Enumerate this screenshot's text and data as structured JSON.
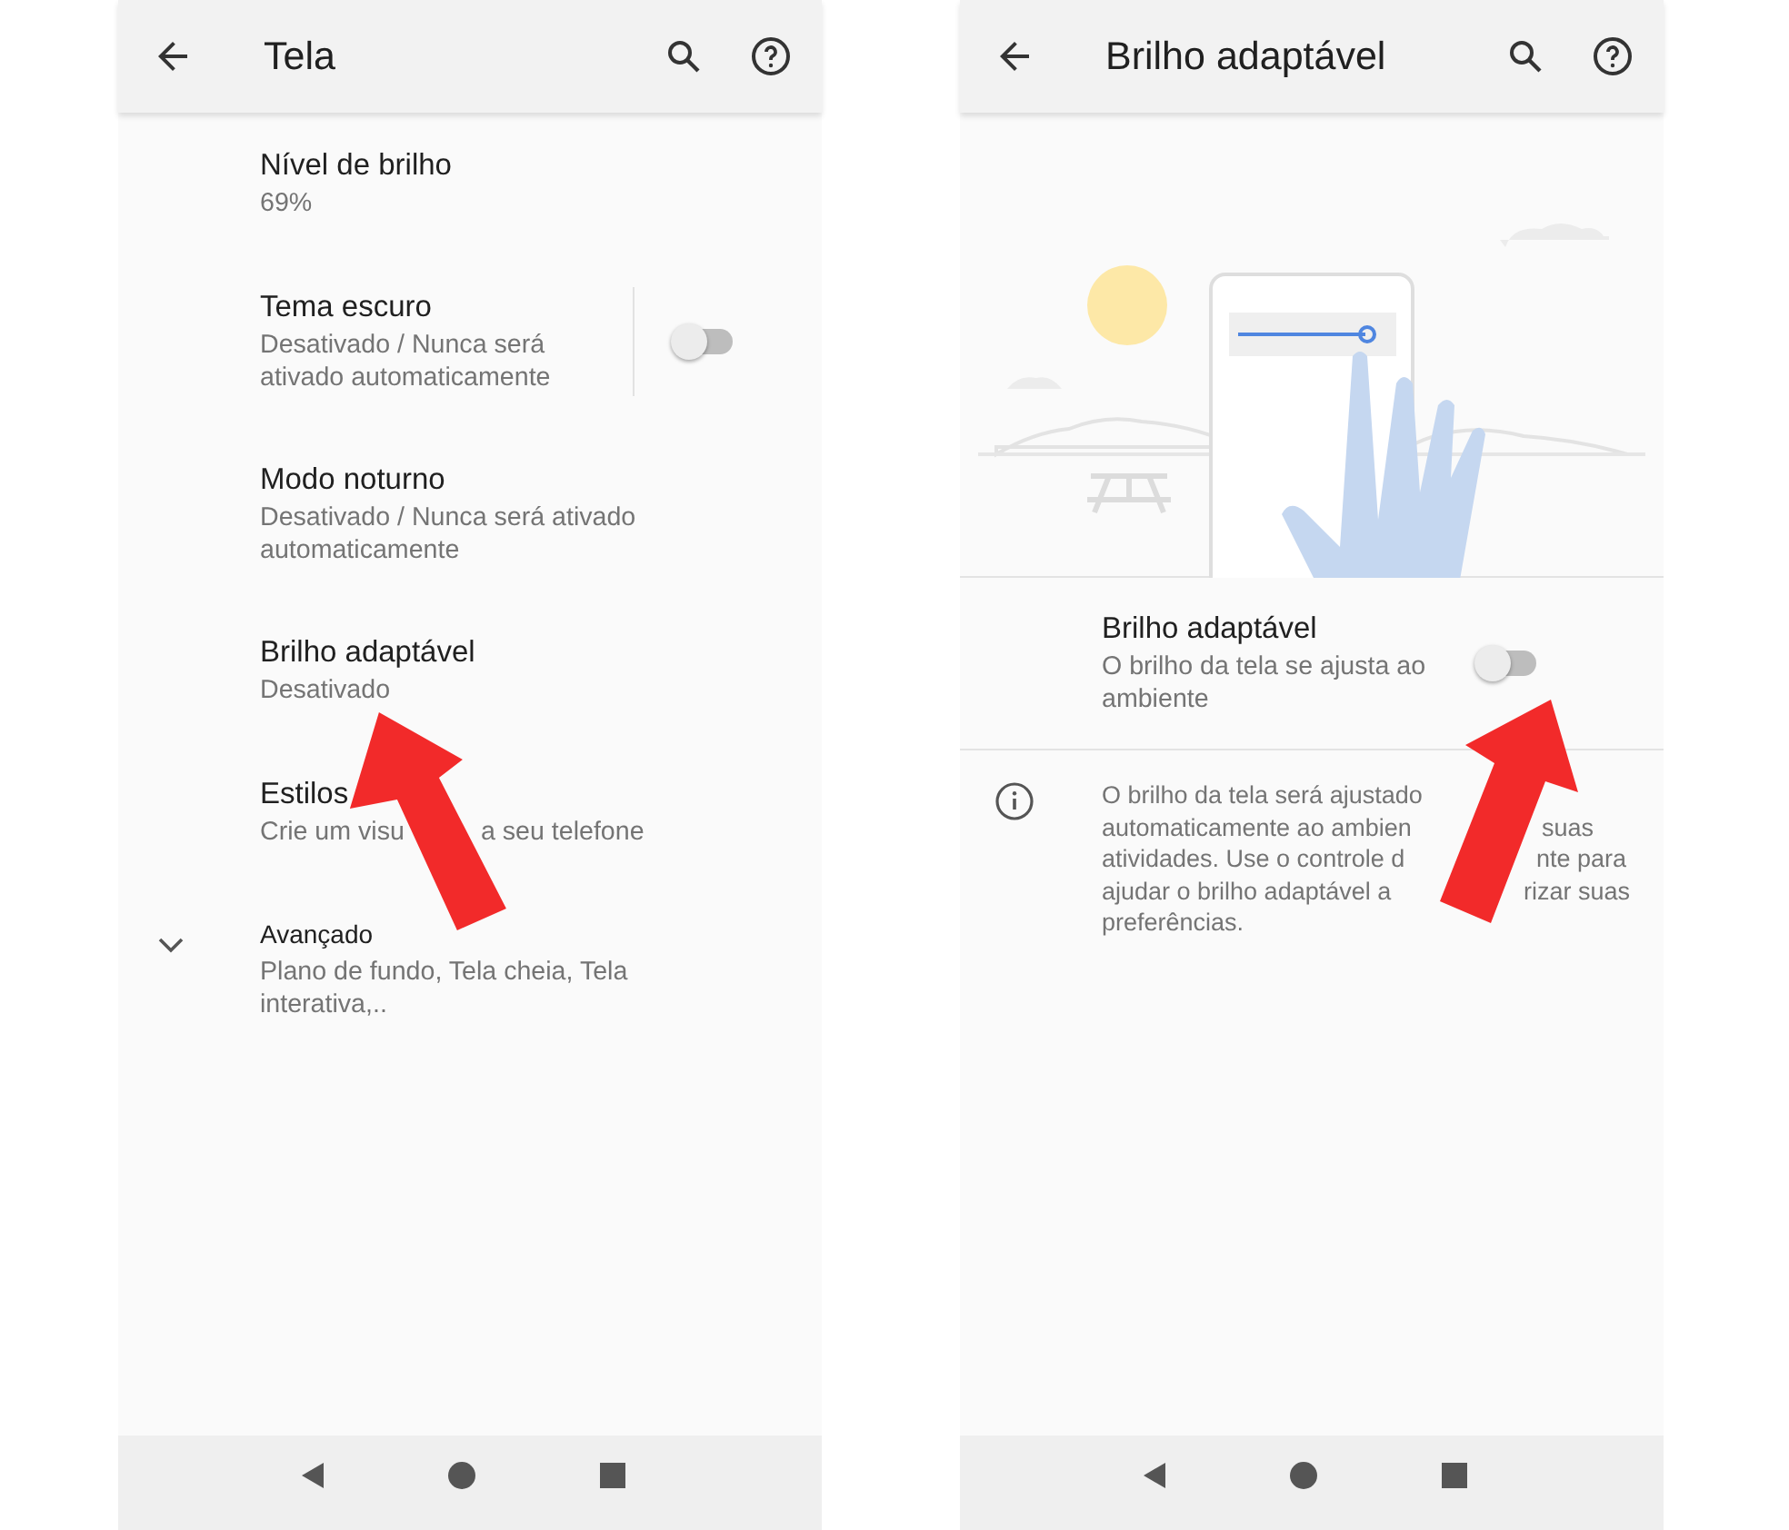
{
  "screens": [
    {
      "title": "Tela",
      "items": [
        {
          "kind": "setting",
          "title": "Nível de brilho",
          "summary": [
            "69%"
          ]
        },
        {
          "kind": "setting",
          "title": "Tema escuro",
          "summary": [
            "Desativado / Nunca será ativado automaticamente"
          ],
          "toggle": {
            "on": false,
            "divider": true
          }
        },
        {
          "kind": "setting",
          "title": "Modo noturno",
          "summary": [
            "Desativado / Nunca será ativado automaticamente"
          ]
        },
        {
          "kind": "setting",
          "title": "Brilho adaptável",
          "summary": [
            "Desativado"
          ]
        },
        {
          "kind": "setting",
          "title": "Estilos",
          "summary": [
            "Crie um visu",
            "a seu telefone"
          ]
        },
        {
          "kind": "expandable",
          "expanded": false,
          "title": "Avançado",
          "summary": [
            "Plano de fundo, Tela cheia, Tela interativa,.."
          ]
        }
      ]
    },
    {
      "title": "Brilho adaptável",
      "items": [
        {
          "kind": "illustration"
        },
        {
          "kind": "setting",
          "title": "Brilho adaptável",
          "summary": [
            "O brilho da tela se ajusta ao ambiente"
          ],
          "toggle": {
            "on": false,
            "divider": false
          }
        },
        {
          "kind": "info",
          "lines": [
            [
              "O brilho da tela será ajustado"
            ],
            [
              "automaticamente ao ambien",
              "suas"
            ],
            [
              "atividades. Use o controle d",
              "nte para"
            ],
            [
              "ajudar o brilho adaptável a",
              "rizar suas"
            ],
            [
              "preferências."
            ]
          ]
        }
      ]
    }
  ]
}
